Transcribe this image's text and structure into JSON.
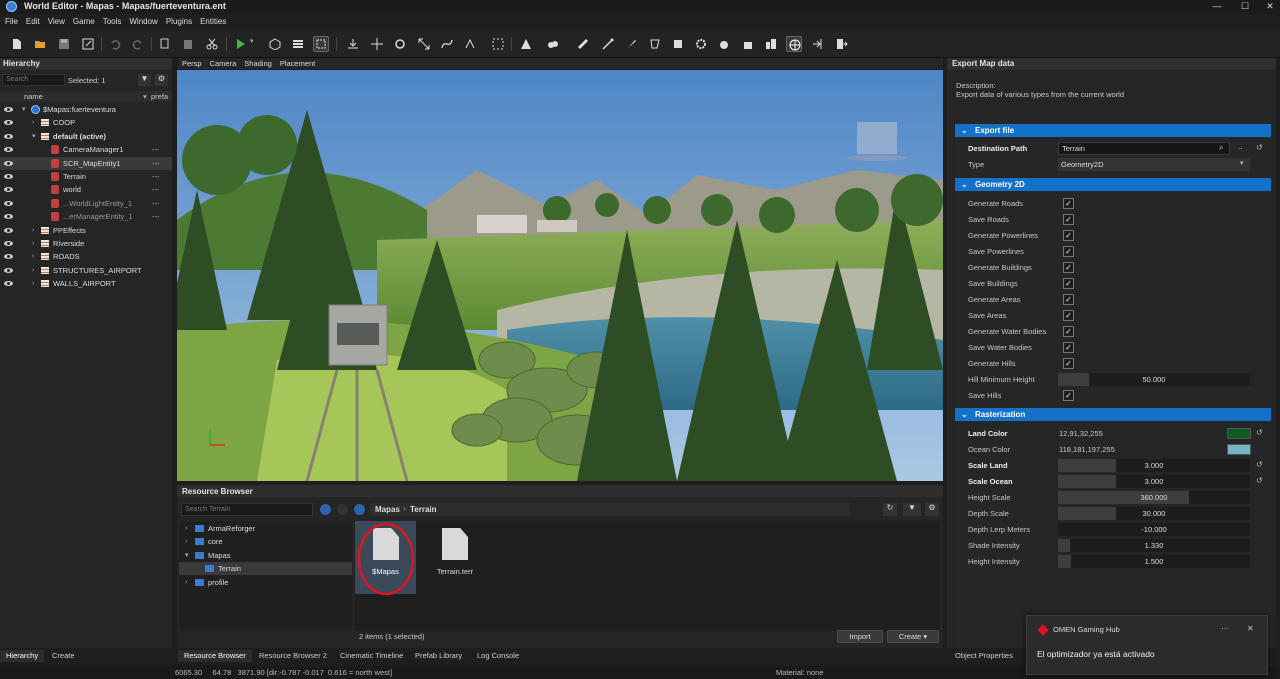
{
  "window": {
    "title": "World Editor - Mapas - Mapas/fuerteventura.ent",
    "controls": [
      "—",
      "☐",
      "✕"
    ]
  },
  "menu": [
    "File",
    "Edit",
    "View",
    "Game",
    "Tools",
    "Window",
    "Plugins",
    "Entities"
  ],
  "viewport_tabs": [
    "Persp",
    "Camera",
    "Shading",
    "Placement"
  ],
  "hierarchy": {
    "title": "Hierarchy",
    "search_placeholder": "Search",
    "selected_label": "Selected: 1",
    "col_name": "name",
    "col_prefab": "prefa",
    "rows": [
      {
        "label": "$Mapas:fuerteventura",
        "icon": "world-icon",
        "indent": 1,
        "caret": "▾",
        "dash": ""
      },
      {
        "label": "COOP",
        "icon": "layer-icon",
        "indent": 2,
        "caret": "›",
        "dash": ""
      },
      {
        "label": "default (active)",
        "icon": "layer-icon",
        "indent": 2,
        "caret": "▾",
        "dash": "",
        "bold": true
      },
      {
        "label": "CameraManager1",
        "icon": "entity-icon",
        "indent": 3,
        "caret": "",
        "dash": "---"
      },
      {
        "label": "SCR_MapEntity1",
        "icon": "entity-icon",
        "indent": 3,
        "caret": "",
        "dash": "---",
        "selected": true
      },
      {
        "label": "Terrain",
        "icon": "entity-icon",
        "indent": 3,
        "caret": "",
        "dash": "---"
      },
      {
        "label": "world",
        "icon": "entity-icon",
        "indent": 3,
        "caret": "",
        "dash": "---"
      },
      {
        "label": "...WorldLightEntity_1",
        "icon": "entity-icon",
        "indent": 3,
        "caret": "",
        "dash": "---",
        "dim": true
      },
      {
        "label": "...erManagerEntity_1",
        "icon": "entity-icon",
        "indent": 3,
        "caret": "",
        "dash": "---",
        "dim": true
      },
      {
        "label": "PPEffects",
        "icon": "layer-icon",
        "indent": 2,
        "caret": "›",
        "dash": ""
      },
      {
        "label": "Riverside",
        "icon": "layer-icon",
        "indent": 2,
        "caret": "›",
        "dash": ""
      },
      {
        "label": "ROADS",
        "icon": "layer-icon",
        "indent": 2,
        "caret": "›",
        "dash": ""
      },
      {
        "label": "STRUCTURES_AIRPORT",
        "icon": "layer-icon",
        "indent": 2,
        "caret": "›",
        "dash": ""
      },
      {
        "label": "WALLS_AIRPORT",
        "icon": "layer-icon",
        "indent": 2,
        "caret": "›",
        "dash": ""
      }
    ]
  },
  "resource_browser": {
    "title": "Resource Browser",
    "search_placeholder": "Search Terrain",
    "breadcrumb": [
      "Mapas",
      "Terrain"
    ],
    "tree": [
      {
        "label": "ArmaReforger",
        "caret": "›",
        "indent": 0
      },
      {
        "label": "core",
        "caret": "›",
        "indent": 0
      },
      {
        "label": "Mapas",
        "caret": "▾",
        "indent": 0
      },
      {
        "label": "Terrain",
        "caret": "",
        "indent": 1,
        "selected": true
      },
      {
        "label": "profile",
        "caret": "›",
        "indent": 0
      }
    ],
    "files": [
      {
        "label": "$Mapas",
        "selected": true
      },
      {
        "label": "Terrain.terr",
        "selected": false
      }
    ],
    "status": "2 items (1 selected)",
    "import_label": "Import",
    "create_label": "Create"
  },
  "bottom_tabs_left": [
    "Hierarchy",
    "Create"
  ],
  "bottom_tabs_center": [
    "Resource Browser",
    "Resource Browser 2",
    "Cinematic Timeline",
    "Prefab Library",
    "Log Console"
  ],
  "bottom_tabs_right": [
    "Object Properties"
  ],
  "status_bar": {
    "coords": "6065.30     64.78   3871.90 [dir:-0.787 -0.017  0.616 = north west]",
    "material": "Material: none"
  },
  "export_panel": {
    "title": "Export Map data",
    "description_label": "Description:",
    "description": "Export data of various types from the current world",
    "sections": {
      "export_file": "Export file",
      "geometry": "Geometry 2D",
      "raster": "Rasterization"
    },
    "destination_label": "Destination Path",
    "destination_value": "Terrain",
    "type_label": "Type",
    "type_value": "Geometry2D",
    "geometry_checks": [
      {
        "label": "Generate Roads",
        "checked": true
      },
      {
        "label": "Save Roads",
        "checked": true
      },
      {
        "label": "Generate Powerlines",
        "checked": true
      },
      {
        "label": "Save Powerlines",
        "checked": true
      },
      {
        "label": "Generate Buildings",
        "checked": true
      },
      {
        "label": "Save Buildings",
        "checked": true
      },
      {
        "label": "Generate Areas",
        "checked": true
      },
      {
        "label": "Save Areas",
        "checked": true
      },
      {
        "label": "Generate Water Bodies",
        "checked": true
      },
      {
        "label": "Save Water Bodies",
        "checked": true
      },
      {
        "label": "Generate Hills",
        "checked": true
      }
    ],
    "hill_min_label": "Hill Minimum Height",
    "hill_min_value": "50.000",
    "hill_min_fill": 0.16,
    "save_hills_label": "Save Hills",
    "land_color_label": "Land Color",
    "land_color_value": "12,91,32,255",
    "land_color_hex": "#0c5b20",
    "ocean_color_label": "Ocean Color",
    "ocean_color_value": "118,181,197,255",
    "ocean_color_hex": "#76b5c5",
    "raster_fields": [
      {
        "label": "Scale Land",
        "value": "3.000",
        "fill": 0.3,
        "bold": true,
        "reset": true
      },
      {
        "label": "Scale Ocean",
        "value": "3.000",
        "fill": 0.3,
        "bold": true,
        "reset": true
      },
      {
        "label": "Height Scale",
        "value": "360.000",
        "fill": 0.68,
        "bold": false,
        "reset": false
      },
      {
        "label": "Depth Scale",
        "value": "30.000",
        "fill": 0.3,
        "bold": false,
        "reset": false
      },
      {
        "label": "Depth Lerp Meters",
        "value": "-10.000",
        "fill": 0.0,
        "bold": false,
        "reset": false
      },
      {
        "label": "Shade Intensity",
        "value": "1.330",
        "fill": 0.06,
        "bold": false,
        "reset": false
      },
      {
        "label": "Height Intensity",
        "value": "1.500",
        "fill": 0.07,
        "bold": false,
        "reset": false
      }
    ]
  },
  "toast": {
    "app": "OMEN Gaming Hub",
    "message": "El optimizador ya está activado",
    "more": "···",
    "close": "✕"
  }
}
